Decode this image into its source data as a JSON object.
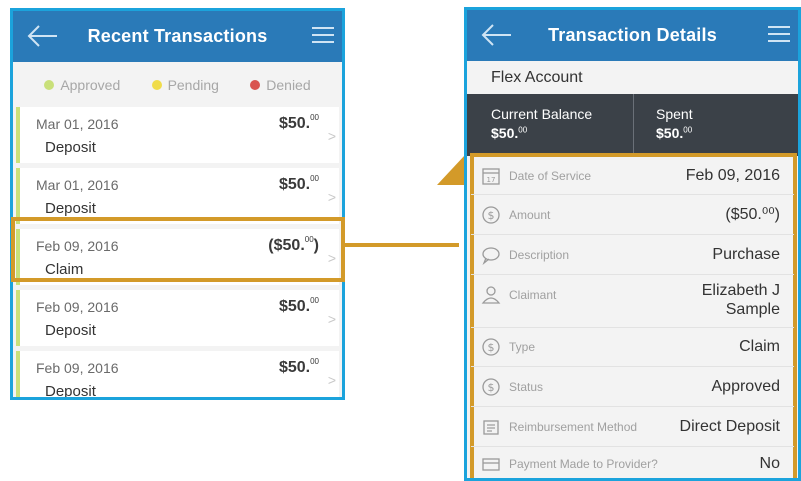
{
  "left_screen": {
    "title": "Recent Transactions",
    "legend": [
      {
        "label": "Approved",
        "color": "#c9e07a"
      },
      {
        "label": "Pending",
        "color": "#f0dc4a"
      },
      {
        "label": "Denied",
        "color": "#d9534f"
      }
    ],
    "transactions": [
      {
        "date": "Mar 01, 2016",
        "type": "Deposit",
        "amount": "$50.",
        "cents": "00"
      },
      {
        "date": "Mar 01, 2016",
        "type": "Deposit",
        "amount": "$50.",
        "cents": "00"
      },
      {
        "date": "Feb 09, 2016",
        "type": "Claim",
        "amount": "($50.",
        "cents": "00",
        "suffix": ")"
      },
      {
        "date": "Feb 09, 2016",
        "type": "Deposit",
        "amount": "$50.",
        "cents": "00"
      },
      {
        "date": "Feb 09, 2016",
        "type": "Deposit",
        "amount": "$50.",
        "cents": "00"
      }
    ]
  },
  "right_screen": {
    "title": "Transaction Details",
    "account": "Flex Account",
    "balances": [
      {
        "label": "Current Balance",
        "value": "$50.",
        "cents": "00"
      },
      {
        "label": "Spent",
        "value": "$50.",
        "cents": "00"
      }
    ],
    "details": [
      {
        "label": "Date of Service",
        "value": "Feb 09, 2016",
        "icon": "calendar-icon"
      },
      {
        "label": "Amount",
        "value": "($50.⁰⁰)",
        "icon": "dollar-icon"
      },
      {
        "label": "Description",
        "value": "Purchase",
        "icon": "speech-bubble-icon"
      },
      {
        "label": "Claimant",
        "value": "Elizabeth J",
        "value2": "Sample",
        "icon": "person-icon"
      },
      {
        "label": "Type",
        "value": "Claim",
        "icon": "dollar-icon"
      },
      {
        "label": "Status",
        "value": "Approved",
        "icon": "dollar-icon"
      },
      {
        "label": "Reimbursement Method",
        "value": "Direct Deposit",
        "icon": "document-icon"
      },
      {
        "label": "Payment Made to Provider?",
        "value": "No",
        "icon": "card-icon"
      }
    ]
  },
  "colors": {
    "nav": "#2a7ab8",
    "frame": "#1ba3dc",
    "highlight": "#d39a29",
    "balance_bg": "#3b4148"
  }
}
